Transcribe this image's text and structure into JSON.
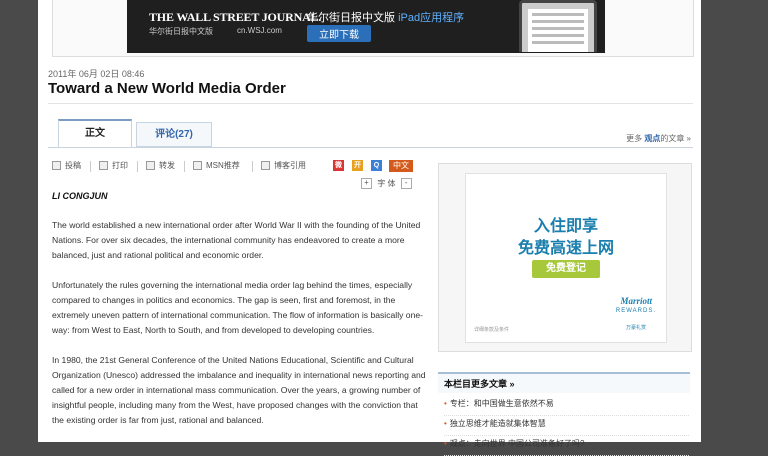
{
  "banner": {
    "wsj_logo": "THE WALL STREET JOURNAL.",
    "wsj_sub": "华尔街日报中文版",
    "wsj_url": "cn.WSJ.com",
    "ipad_text_prefix": "华尔街日报中文版",
    "ipad_text_accent": "iPad应用程序",
    "download_label": "立即下载"
  },
  "article": {
    "date": "2011年 06月 02日 08:46",
    "title": "Toward a New World Media Order",
    "byline": "LI CONGJUN",
    "paragraphs": [
      "The world established a new international order after World War II with the founding of the United Nations. For over six decades, the international community has endeavored to create a more balanced, just and rational political and economic order.",
      "Unfortunately the rules governing the international media order lag behind the times, especially compared to changes in politics and economics. The gap is seen, first and foremost, in the extremely uneven pattern of international communication. The flow of information is basically one-way: from West to East, North to South, and from developed to developing countries.",
      "In 1980, the 21st General Conference of the United Nations Educational, Scientific and Cultural Organization (Unesco) addressed the imbalance and inequality in international news reporting and called for a new order in international mass communication. Over the years, a growing number of insightful people, including many from the West, have proposed changes with the conviction that the existing order is far from just, rational and balanced."
    ]
  },
  "tabs": {
    "main": "正文",
    "comments": "评论(27)"
  },
  "more_articles": {
    "prefix": "更多",
    "bold": "观点",
    "suffix": "的文章 »"
  },
  "toolbar": {
    "items": [
      "投稿",
      "打印",
      "转发",
      "MSN推荐",
      "博客引用"
    ],
    "zh_label": "中文",
    "font_label": "字 体",
    "plus": "+",
    "minus": "-"
  },
  "ad": {
    "line1": "入住即享",
    "line2": "免费高速上网",
    "button": "免费登记",
    "small_print": "详细条款及条件",
    "brand": "Marriott",
    "brand_sub": "REWARDS.",
    "brand_cn": "万豪礼赏"
  },
  "sidebar": {
    "heading": "本栏目更多文章 »",
    "items": [
      "专栏：和中国做生意依然不易",
      "独立思维才能造就集体智慧",
      "观点：走向世界 中国公司准备好了吗?"
    ]
  },
  "colors": {
    "accent_blue": "#3366aa",
    "ad_blue": "#1a7fae",
    "ad_green": "#a6c83a",
    "zh_orange": "#d45a1c"
  }
}
